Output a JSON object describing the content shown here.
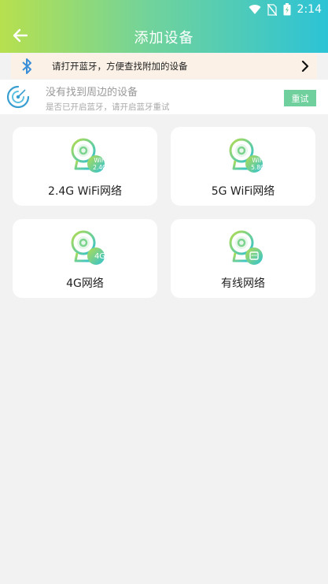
{
  "status_bar": {
    "time": "2:14"
  },
  "header": {
    "title": "添加设备",
    "back_icon": "arrow-left-icon"
  },
  "bluetooth_banner": {
    "text": "请打开蓝牙，方便查找附加的设备"
  },
  "no_device": {
    "title": "没有找到周边的设备",
    "subtitle": "是否已开启蓝牙，请开启蓝牙重试",
    "retry_label": "重试"
  },
  "devices": [
    {
      "label": "2.4G WiFi网络",
      "badge_top": "WiFi",
      "badge_bottom": "2.4G"
    },
    {
      "label": "5G WiFi网络",
      "badge_top": "WiFi",
      "badge_bottom": "5.8G"
    },
    {
      "label": "4G网络",
      "badge": "4G"
    },
    {
      "label": "有线网络",
      "badge_icon": "ethernet-icon"
    }
  ],
  "colors": {
    "header_start": "#b7e04e",
    "header_end": "#2cc3d6",
    "accent": "#6fcf9d",
    "banner_bg": "#fbf1e6"
  }
}
